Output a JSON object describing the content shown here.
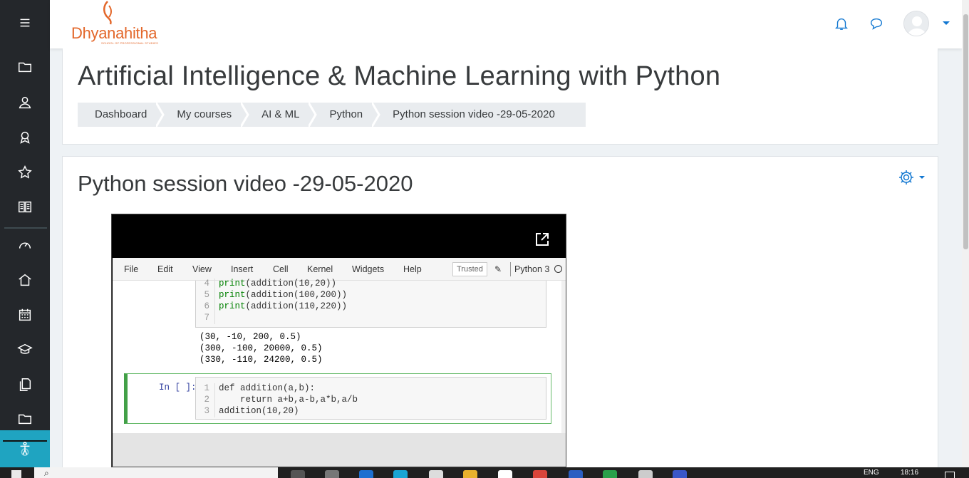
{
  "app": {
    "logo_text": "Dhyanahitha",
    "logo_subtext": "SCHOOL OF PROFESSIONAL STUDIES",
    "brand_color": "#e3672a",
    "accent_color": "#1177d1"
  },
  "sidebar": {
    "items": [
      {
        "icon": "menu-icon"
      },
      {
        "icon": "folder-icon"
      },
      {
        "icon": "participants-icon"
      },
      {
        "icon": "badge-icon"
      },
      {
        "icon": "star-icon"
      },
      {
        "icon": "grades-icon"
      },
      {
        "icon": "dashboard-icon"
      },
      {
        "icon": "home-icon"
      },
      {
        "icon": "calendar-icon"
      },
      {
        "icon": "graduation-cap-icon"
      },
      {
        "icon": "files-icon"
      },
      {
        "icon": "folder-icon"
      },
      {
        "icon": "accessibility-icon"
      }
    ]
  },
  "header": {
    "title": "Artificial Intelligence & Machine Learning with Python",
    "breadcrumb": [
      "Dashboard",
      "My courses",
      "AI & ML",
      "Python",
      "Python session video -29-05-2020"
    ]
  },
  "main": {
    "section_title": "Python session video -29-05-2020"
  },
  "notebook": {
    "menu": [
      "File",
      "Edit",
      "View",
      "Insert",
      "Cell",
      "Kernel",
      "Widgets",
      "Help"
    ],
    "trusted": "Trusted",
    "kernel": "Python 3",
    "cell1_lines": [
      {
        "n": "4",
        "fn": "print",
        "args": "(addition(10,20))"
      },
      {
        "n": "5",
        "fn": "print",
        "args": "(addition(100,200))"
      },
      {
        "n": "6",
        "fn": "print",
        "args": "(addition(110,220))"
      },
      {
        "n": "7",
        "fn": "",
        "args": ""
      }
    ],
    "outputs": [
      "(30, -10, 200, 0.5)",
      "(300, -100, 20000, 0.5)",
      "(330, -110, 24200, 0.5)"
    ],
    "cell2_prompt": "In [ ]:",
    "cell2_lines": [
      {
        "n": "1",
        "text": "def addition(a,b):"
      },
      {
        "n": "2",
        "text": "    return a+b,a-b,a*b,a/b"
      },
      {
        "n": "3",
        "text": "addition(10,20)"
      }
    ]
  },
  "taskbar": {
    "language": "ENG",
    "time": "18:16"
  }
}
